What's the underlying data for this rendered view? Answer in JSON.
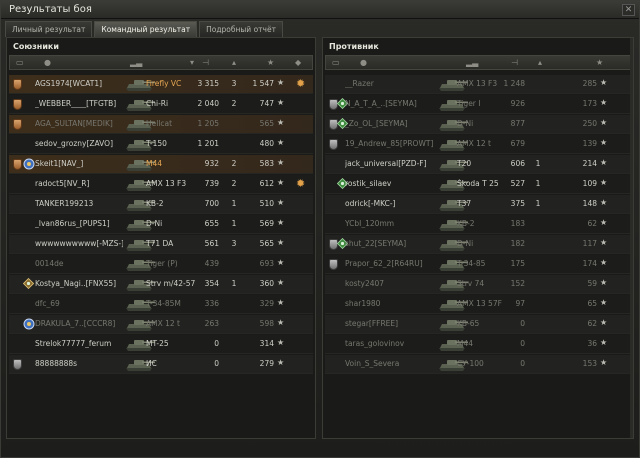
{
  "window": {
    "title": "Результаты боя"
  },
  "tabs": [
    "Личный результат",
    "Командный результат",
    "Подробный отчёт"
  ],
  "active_tab": 1,
  "left": {
    "title": "Союзники",
    "rows": [
      {
        "name": "AGS1974[WCAT1]",
        "tank": "Firefly VC",
        "dmg": "3 315",
        "kills": "3",
        "xp": "1 547",
        "badge": "orange",
        "gear": true,
        "player": true,
        "dead": false,
        "gold": true
      },
      {
        "name": "_WEBBER____[TFGTB]",
        "tank": "Chi-Ri",
        "dmg": "2 040",
        "kills": "2",
        "xp": "747",
        "badge": "orange",
        "gear": false,
        "player": false,
        "dead": false,
        "gold": false
      },
      {
        "name": "AGA_SULTAN[MEDIK]",
        "tank": "Hellcat",
        "dmg": "1 205",
        "kills": "",
        "xp": "565",
        "badge": "orange",
        "gear": false,
        "player": true,
        "dead": true,
        "gold": false
      },
      {
        "name": "sedov_grozny[ZAVO]",
        "tank": "T-150",
        "dmg": "1 201",
        "kills": "",
        "xp": "480",
        "badge": "",
        "gear": false,
        "player": false,
        "dead": false,
        "gold": false
      },
      {
        "name": "Skeit1[NAV_]",
        "tank": "M44",
        "dmg": "932",
        "kills": "2",
        "xp": "583",
        "badge": "orange",
        "gear": false,
        "player": true,
        "dead": false,
        "gold": true
      },
      {
        "name": "radoct5[NV_R]",
        "tank": "AMX 13 F3",
        "dmg": "739",
        "kills": "2",
        "xp": "612",
        "badge": "",
        "gear": true,
        "player": false,
        "dead": false,
        "gold": false
      },
      {
        "name": "TANKER199213",
        "tank": "KB-2",
        "dmg": "700",
        "kills": "1",
        "xp": "510",
        "badge": "",
        "gear": false,
        "player": false,
        "dead": false,
        "gold": false
      },
      {
        "name": "_Ivan86rus_[PUPS1]",
        "tank": "D-Ni",
        "dmg": "655",
        "kills": "1",
        "xp": "569",
        "badge": "",
        "gear": false,
        "player": false,
        "dead": false,
        "gold": false
      },
      {
        "name": "wwwwwwwwww[-MZS-]",
        "tank": "T71 DA",
        "dmg": "561",
        "kills": "3",
        "xp": "565",
        "badge": "",
        "gear": false,
        "player": false,
        "dead": false,
        "gold": false
      },
      {
        "name": "0014de",
        "tank": "Tiger (P)",
        "dmg": "439",
        "kills": "",
        "xp": "693",
        "badge": "",
        "gear": false,
        "player": false,
        "dead": true,
        "gold": false
      },
      {
        "name": "Kostya_Nagi..[FNX55]",
        "tank": "Strv m/42-57",
        "dmg": "354",
        "kills": "1",
        "xp": "360",
        "badge": "",
        "gear": false,
        "player": false,
        "dead": false,
        "gold": false
      },
      {
        "name": "dfc_69",
        "tank": "T-34-85M",
        "dmg": "336",
        "kills": "",
        "xp": "329",
        "badge": "",
        "gear": false,
        "player": false,
        "dead": true,
        "gold": false
      },
      {
        "name": "DRAKULA_7..[CCCR8]",
        "tank": "AMX 12 t",
        "dmg": "263",
        "kills": "",
        "xp": "598",
        "badge": "",
        "gear": false,
        "player": false,
        "dead": true,
        "gold": false
      },
      {
        "name": "Strelok77777_ferum",
        "tank": "MT-25",
        "dmg": "0",
        "kills": "",
        "xp": "314",
        "badge": "",
        "gear": false,
        "player": false,
        "dead": false,
        "gold": false
      },
      {
        "name": "88888888s",
        "tank": "ИС",
        "dmg": "0",
        "kills": "",
        "xp": "279",
        "badge": "gray",
        "gear": false,
        "player": false,
        "dead": false,
        "gold": false
      }
    ]
  },
  "right": {
    "title": "Противник",
    "rows": [
      {
        "name": "__Razer",
        "tank": "AMX 13 F3",
        "dmg": "1 248",
        "kills": "",
        "xp": "285",
        "badge": "",
        "squad": false,
        "dead": true
      },
      {
        "name": "N_A_T_A_..[SEYMA]",
        "tank": "Tiger I",
        "dmg": "926",
        "kills": "",
        "xp": "173",
        "badge": "gray",
        "squad": true,
        "dead": true
      },
      {
        "name": "_Zo_OL_[SEYMA]",
        "tank": "D-Ni",
        "dmg": "877",
        "kills": "",
        "xp": "250",
        "badge": "gray",
        "squad": true,
        "dead": true
      },
      {
        "name": "19_Andrew_85[PROWT]",
        "tank": "AMX 12 t",
        "dmg": "679",
        "kills": "",
        "xp": "139",
        "badge": "gray",
        "squad": false,
        "dead": true
      },
      {
        "name": "jack_universal[PZD-F]",
        "tank": "T20",
        "dmg": "606",
        "kills": "1",
        "xp": "214",
        "badge": "",
        "squad": false,
        "dead": false
      },
      {
        "name": "rostik_silaev",
        "tank": "Škoda T 25",
        "dmg": "527",
        "kills": "1",
        "xp": "109",
        "badge": "",
        "squad": true,
        "dead": false
      },
      {
        "name": "odrick[-MKC-]",
        "tank": "T37",
        "dmg": "375",
        "kills": "1",
        "xp": "148",
        "badge": "",
        "squad": false,
        "dead": false
      },
      {
        "name": "YCbI_120mm",
        "tank": "KB-2",
        "dmg": "183",
        "kills": "",
        "xp": "62",
        "badge": "",
        "squad": false,
        "dead": true
      },
      {
        "name": "shut_22[SEYMA]",
        "tank": "D-Ni",
        "dmg": "182",
        "kills": "",
        "xp": "117",
        "badge": "gray",
        "squad": true,
        "dead": true
      },
      {
        "name": "Prapor_62_2[R64RU]",
        "tank": "T-34-85",
        "dmg": "175",
        "kills": "",
        "xp": "174",
        "badge": "gray",
        "squad": false,
        "dead": true
      },
      {
        "name": "kosty2407",
        "tank": "Strv 74",
        "dmg": "152",
        "kills": "",
        "xp": "59",
        "badge": "",
        "squad": false,
        "dead": true
      },
      {
        "name": "shar1980",
        "tank": "AMX 13 57F",
        "dmg": "97",
        "kills": "",
        "xp": "65",
        "badge": "",
        "squad": false,
        "dead": true
      },
      {
        "name": "stegar[FFREE]",
        "tank": "KB-65",
        "dmg": "0",
        "kills": "",
        "xp": "62",
        "badge": "",
        "squad": false,
        "dead": true
      },
      {
        "name": "taras_golovinov",
        "tank": "M44",
        "dmg": "0",
        "kills": "",
        "xp": "36",
        "badge": "",
        "squad": false,
        "dead": true
      },
      {
        "name": "Voin_S_Severa",
        "tank": "СУ-100",
        "dmg": "0",
        "kills": "",
        "xp": "153",
        "badge": "",
        "squad": false,
        "dead": true
      }
    ]
  },
  "icons": {
    "star": "xp-star-icon",
    "gear": "medal-gear-icon",
    "badge": "rank-badge-icon",
    "squad": "squad-diamond-icon"
  }
}
